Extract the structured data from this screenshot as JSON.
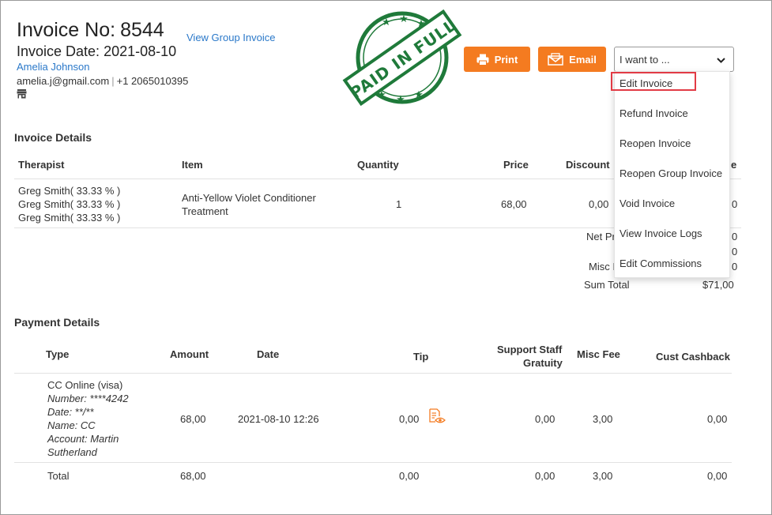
{
  "header": {
    "invoice_label": "Invoice No:",
    "invoice_number": "8544",
    "view_group_invoice": "View Group Invoice",
    "invoice_date_label": "Invoice Date:",
    "invoice_date": "2021-08-10",
    "customer_name": "Amelia Johnson",
    "customer_email": "amelia.j@gmail.com",
    "separator": "|",
    "customer_phone": "+1 2065010395",
    "store_icon": "store-icon"
  },
  "stamp": {
    "text": "PAID IN FULL",
    "color": "#1f7a3a"
  },
  "actions": {
    "print_label": "Print",
    "email_label": "Email",
    "accent_color": "#f47b20",
    "select_value": "I want to ..."
  },
  "menu": {
    "items": [
      {
        "label": "Edit Invoice",
        "highlighted": true
      },
      {
        "label": "Refund Invoice"
      },
      {
        "label": "Reopen Invoice"
      },
      {
        "label": "Reopen Group Invoice"
      },
      {
        "label": "Void Invoice"
      },
      {
        "label": "View Invoice Logs"
      },
      {
        "label": "Edit Commissions"
      }
    ]
  },
  "invoice_details": {
    "title": "Invoice Details",
    "columns": {
      "therapist": "Therapist",
      "item": "Item",
      "quantity": "Quantity",
      "price": "Price",
      "discount": "Discount",
      "last_partial": "e"
    },
    "row": {
      "therapists": [
        "Greg Smith( 33.33 % )",
        "Greg Smith( 33.33 % )",
        "Greg Smith( 33.33 % )"
      ],
      "item_line1": "Anti-Yellow Violet Conditioner",
      "item_line2": "Treatment",
      "quantity": "1",
      "price": "68,00",
      "discount": "0,00",
      "last_partial": "0"
    },
    "totals": {
      "net_label_partial": "Net Pr",
      "misc_label_partial": "Misc I",
      "values_partial": [
        "0",
        "0",
        "0"
      ],
      "sum_total_label": "Sum Total",
      "sum_total_value": "$71,00"
    }
  },
  "payment_details": {
    "title": "Payment Details",
    "columns": {
      "type": "Type",
      "amount": "Amount",
      "date": "Date",
      "tip": "Tip",
      "support_line1": "Support Staff",
      "support_line2": "Gratuity",
      "misc_fee": "Misc Fee",
      "cust_cashback": "Cust Cashback"
    },
    "row": {
      "type": "CC Online (visa)",
      "number": "Number: ****4242",
      "date_masked": "Date: **/**",
      "name": "Name: CC",
      "account_line1": "Account: Martin",
      "account_line2": "Sutherland",
      "amount": "68,00",
      "date": "2021-08-10 12:26",
      "tip": "0,00",
      "tip_icon": "receipt-eye-icon",
      "support": "0,00",
      "misc_fee": "3,00",
      "cashback": "0,00"
    },
    "total": {
      "label": "Total",
      "amount": "68,00",
      "tip": "0,00",
      "support": "0,00",
      "misc_fee": "3,00",
      "cashback": "0,00"
    }
  }
}
